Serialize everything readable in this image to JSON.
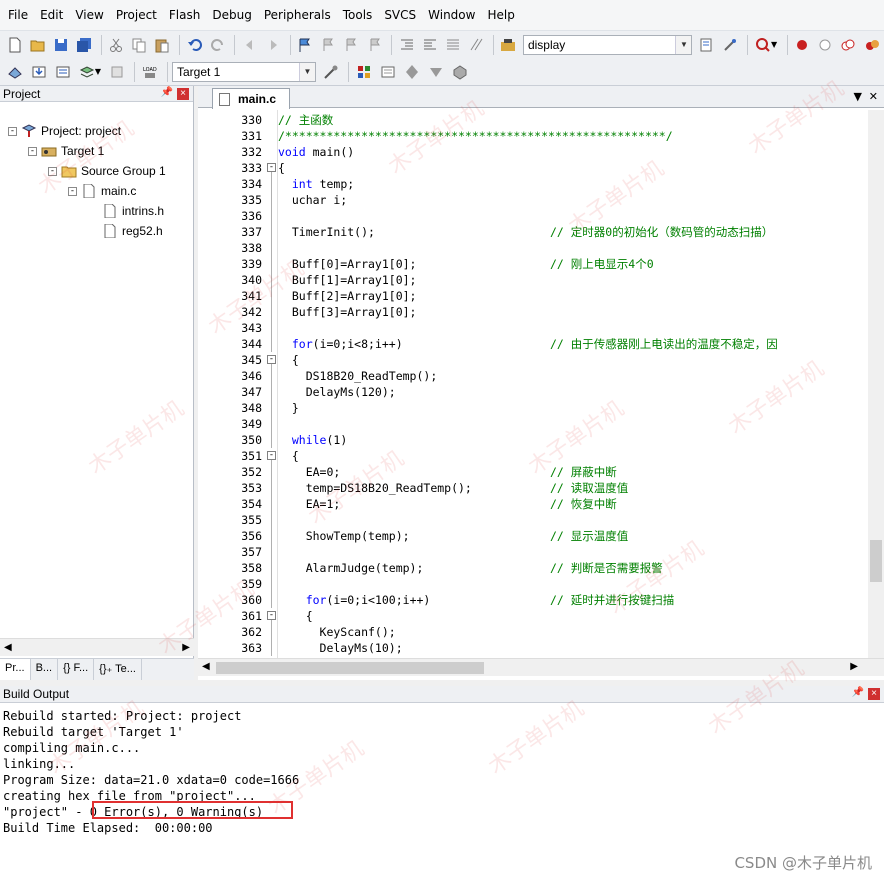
{
  "menu": [
    "File",
    "Edit",
    "View",
    "Project",
    "Flash",
    "Debug",
    "Peripherals",
    "Tools",
    "SVCS",
    "Window",
    "Help"
  ],
  "toolbar": {
    "find_combo": "display",
    "target_combo": "Target 1"
  },
  "project_pane": {
    "title": "Project",
    "tree": [
      {
        "label": "Project: project",
        "level": 0,
        "icon": "project-icon",
        "expander": "-"
      },
      {
        "label": "Target 1",
        "level": 1,
        "icon": "target-icon",
        "expander": "-"
      },
      {
        "label": "Source Group 1",
        "level": 2,
        "icon": "folder-icon",
        "expander": "-"
      },
      {
        "label": "main.c",
        "level": 3,
        "icon": "file-icon",
        "expander": "-"
      },
      {
        "label": "intrins.h",
        "level": 4,
        "icon": "header-file-icon",
        "expander": ""
      },
      {
        "label": "reg52.h",
        "level": 4,
        "icon": "header-file-icon",
        "expander": ""
      }
    ],
    "tabs": [
      "Pr...",
      "B...",
      "{} F...",
      "{}₊ Te..."
    ]
  },
  "editor": {
    "tab_label": "main.c",
    "lines": [
      {
        "n": "330",
        "fold": "",
        "text": "// 主函数",
        "type": "comment"
      },
      {
        "n": "331",
        "fold": "",
        "text": "/*******************************************************/",
        "type": "comment"
      },
      {
        "n": "332",
        "fold": "",
        "text": "void main()",
        "type": "code"
      },
      {
        "n": "333",
        "fold": "-",
        "text": "{",
        "type": "code"
      },
      {
        "n": "334",
        "fold": "|",
        "text": "  int temp;",
        "type": "code"
      },
      {
        "n": "335",
        "fold": "|",
        "text": "  uchar i;",
        "type": "code"
      },
      {
        "n": "336",
        "fold": "|",
        "text": "",
        "type": "code"
      },
      {
        "n": "337",
        "fold": "|",
        "text": "  TimerInit();",
        "comment": "// 定时器0的初始化（数码管的动态扫描）",
        "type": "code"
      },
      {
        "n": "338",
        "fold": "|",
        "text": "",
        "type": "code"
      },
      {
        "n": "339",
        "fold": "|",
        "text": "  Buff[0]=Array1[0];",
        "comment": "// 刚上电显示4个0",
        "type": "code"
      },
      {
        "n": "340",
        "fold": "|",
        "text": "  Buff[1]=Array1[0];",
        "type": "code"
      },
      {
        "n": "341",
        "fold": "|",
        "text": "  Buff[2]=Array1[0];",
        "type": "code"
      },
      {
        "n": "342",
        "fold": "|",
        "text": "  Buff[3]=Array1[0];",
        "type": "code"
      },
      {
        "n": "343",
        "fold": "|",
        "text": "",
        "type": "code"
      },
      {
        "n": "344",
        "fold": "|",
        "text": "  for(i=0;i<8;i++)",
        "comment": "// 由于传感器刚上电读出的温度不稳定，因",
        "type": "code"
      },
      {
        "n": "345",
        "fold": "-",
        "text": "  {",
        "type": "code"
      },
      {
        "n": "346",
        "fold": "|",
        "text": "    DS18B20_ReadTemp();",
        "type": "code"
      },
      {
        "n": "347",
        "fold": "|",
        "text": "    DelayMs(120);",
        "type": "code"
      },
      {
        "n": "348",
        "fold": "|",
        "text": "  }",
        "type": "code"
      },
      {
        "n": "349",
        "fold": "|",
        "text": "",
        "type": "code"
      },
      {
        "n": "350",
        "fold": "|",
        "text": "  while(1)",
        "type": "code"
      },
      {
        "n": "351",
        "fold": "-",
        "text": "  {",
        "type": "code"
      },
      {
        "n": "352",
        "fold": "|",
        "text": "    EA=0;",
        "comment": "// 屏蔽中断",
        "type": "code"
      },
      {
        "n": "353",
        "fold": "|",
        "text": "    temp=DS18B20_ReadTemp();",
        "comment": "// 读取温度值",
        "type": "code"
      },
      {
        "n": "354",
        "fold": "|",
        "text": "    EA=1;",
        "comment": "// 恢复中断",
        "type": "code"
      },
      {
        "n": "355",
        "fold": "|",
        "text": "",
        "type": "code"
      },
      {
        "n": "356",
        "fold": "|",
        "text": "    ShowTemp(temp);",
        "comment": "// 显示温度值",
        "type": "code"
      },
      {
        "n": "357",
        "fold": "|",
        "text": "",
        "type": "code"
      },
      {
        "n": "358",
        "fold": "|",
        "text": "    AlarmJudge(temp);",
        "comment": "// 判断是否需要报警",
        "type": "code"
      },
      {
        "n": "359",
        "fold": "|",
        "text": "",
        "type": "code"
      },
      {
        "n": "360",
        "fold": "|",
        "text": "    for(i=0;i<100;i++)",
        "comment": "// 延时并进行按键扫描",
        "type": "code"
      },
      {
        "n": "361",
        "fold": "-",
        "text": "    {",
        "type": "code"
      },
      {
        "n": "362",
        "fold": "|",
        "text": "      KeyScanf();",
        "type": "code"
      },
      {
        "n": "363",
        "fold": "|",
        "text": "      DelayMs(10);",
        "type": "code"
      }
    ]
  },
  "build_output": {
    "title": "Build Output",
    "lines": [
      "Rebuild started: Project: project",
      "Rebuild target 'Target 1'",
      "compiling main.c...",
      "linking...",
      "Program Size: data=21.0 xdata=0 code=1666",
      "creating hex file from \"project\"...",
      "\"project\" - 0 Error(s), 0 Warning(s)",
      "Build Time Elapsed:  00:00:00"
    ]
  },
  "watermark_text": "木子单片机",
  "footer_credit": "CSDN @木子单片机"
}
